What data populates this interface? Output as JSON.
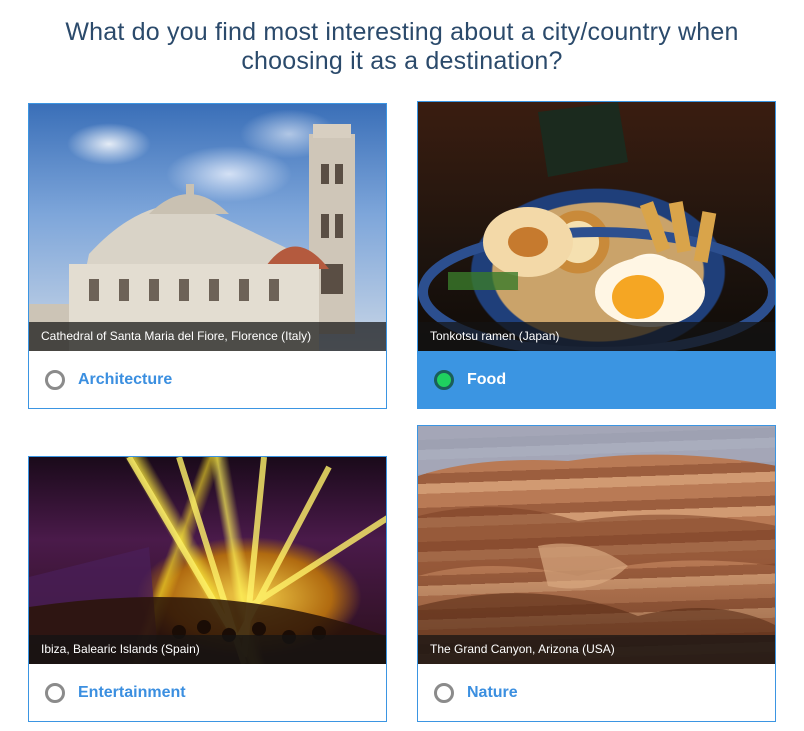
{
  "question": "What do you find most interesting about a city/country when choosing it as a destination?",
  "options": [
    {
      "caption": "Cathedral of Santa Maria del Fiore, Florence (Italy)",
      "label": "Architecture",
      "selected": false
    },
    {
      "caption": "Tonkotsu ramen (Japan)",
      "label": "Food",
      "selected": true
    },
    {
      "caption": "Ibiza, Balearic Islands (Spain)",
      "label": "Entertainment",
      "selected": false
    },
    {
      "caption": "The Grand Canyon, Arizona (USA)",
      "label": "Nature",
      "selected": false
    }
  ],
  "colors": {
    "accent": "#3b95e2",
    "title": "#2b4a6b",
    "selected_radio": "#1fd15f"
  }
}
